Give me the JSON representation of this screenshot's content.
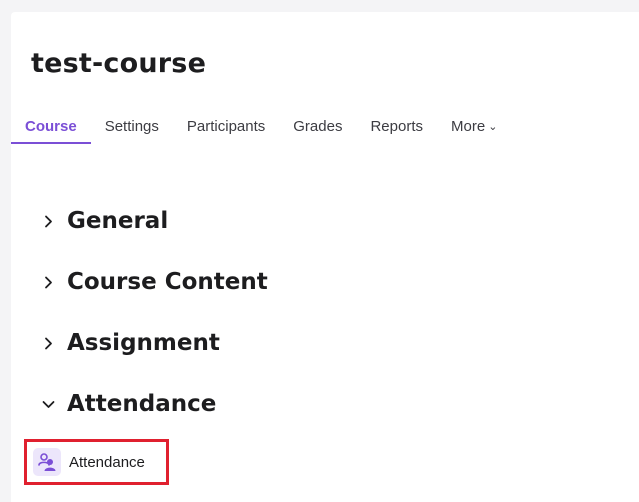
{
  "course": {
    "title": "test-course"
  },
  "tabs": [
    {
      "label": "Course",
      "active": true
    },
    {
      "label": "Settings",
      "active": false
    },
    {
      "label": "Participants",
      "active": false
    },
    {
      "label": "Grades",
      "active": false
    },
    {
      "label": "Reports",
      "active": false
    },
    {
      "label": "More",
      "active": false
    }
  ],
  "sections": [
    {
      "label": "General",
      "expanded": false
    },
    {
      "label": "Course Content",
      "expanded": false
    },
    {
      "label": "Assignment",
      "expanded": false
    },
    {
      "label": "Attendance",
      "expanded": true
    }
  ],
  "activity": {
    "label": "Attendance",
    "icon": "attendance-icon"
  },
  "colors": {
    "accent": "#7b4fd6",
    "highlight_border": "#e0202f",
    "text": "#1d1d1f"
  }
}
